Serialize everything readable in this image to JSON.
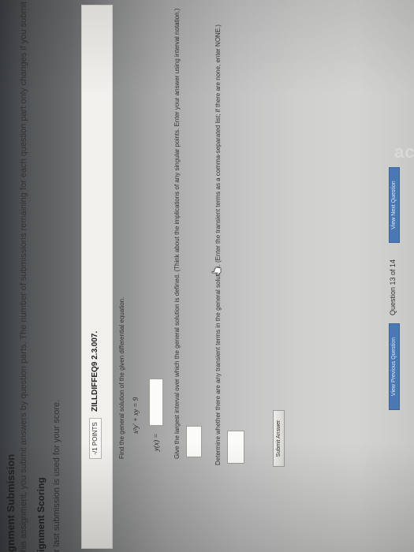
{
  "header": {
    "title": "gnment Submission",
    "info_text": "his assignment, you submit answers by question parts. The number of submissions remaining for each question part only changes if you submit or change",
    "scoring_title": "ignment Scoring",
    "scoring_text": "r last submission is used for your score."
  },
  "question": {
    "points_label": "-/1 POINTS",
    "id": "ZILLDIFFEQ9 2.3.007.",
    "prompt": "Find the general solution of the given differential equation.",
    "equation": "x²y' + xy = 9",
    "answer_label": "y(x) =",
    "interval_prompt": "Give the largest interval over which the general solution is defined. (Think about the implications of any singular points. Enter your answer using interval notation.)",
    "transient_prompt": "Determine whether there are any transient terms in the general solution. (Enter the transient terms as a comma-separated list; if there are none, enter NONE.)",
    "submit_label": "Submit Answer"
  },
  "navigation": {
    "prev_label": "View Previous Question",
    "counter": "Question 13 of 14",
    "next_label": "View Next Question"
  },
  "overlay": {
    "logo_text": "acer"
  }
}
